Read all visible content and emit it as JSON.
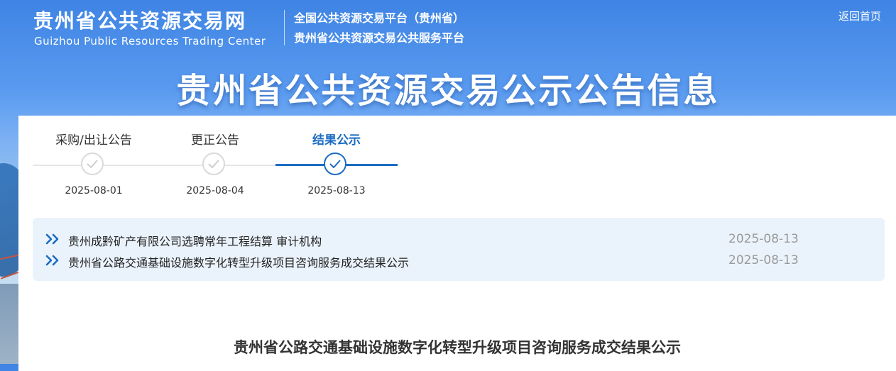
{
  "header": {
    "logo_cn": "贵州省公共资源交易网",
    "logo_en": "Guizhou Public Resources Trading Center",
    "platform_line1": "全国公共资源交易平台（贵州省）",
    "platform_line2": "贵州省公共资源交易公共服务平台",
    "home_link": "返回首页"
  },
  "banner": {
    "title": "贵州省公共资源交易公示公告信息"
  },
  "steps": [
    {
      "label": "采购/出让公告",
      "date": "2025-08-01",
      "active": false
    },
    {
      "label": "更正公告",
      "date": "2025-08-04",
      "active": false
    },
    {
      "label": "结果公示",
      "date": "2025-08-13",
      "active": true
    }
  ],
  "list": [
    {
      "title": "贵州成黔矿产有限公司选聘常年工程结算 审计机构",
      "date": "2025-08-13"
    },
    {
      "title": "贵州省公路交通基础设施数字化转型升级项目咨询服务成交结果公示",
      "date": "2025-08-13"
    }
  ],
  "document": {
    "title": "贵州省公路交通基础设施数字化转型升级项目咨询服务成交结果公示"
  },
  "colors": {
    "accent": "#1b6cc2",
    "list_bg": "#eaf3fc",
    "inactive": "#d9d9d9"
  },
  "icons": {
    "step": "check-circle-icon",
    "list": "double-chevron-right-icon"
  }
}
